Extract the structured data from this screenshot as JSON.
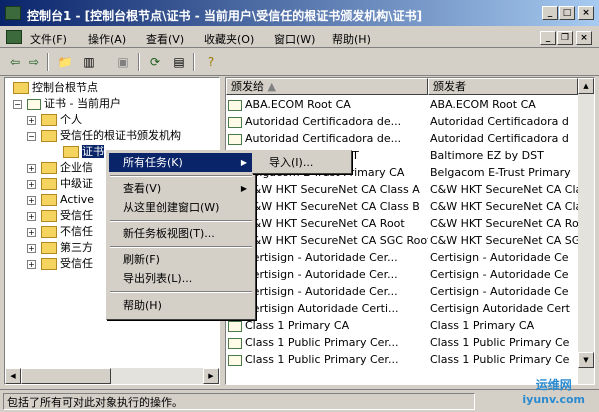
{
  "window": {
    "title": "控制台1 - [控制台根节点\\证书 - 当前用户\\受信任的根证书颁发机构\\证书]",
    "minimize": "_",
    "maximize": "□",
    "close": "×"
  },
  "menubar": {
    "items": [
      "文件(F)",
      "操作(A)",
      "查看(V)",
      "收藏夹(O)",
      "窗口(W)",
      "帮助(H)"
    ],
    "inner_min": "_",
    "inner_restore": "❐",
    "inner_close": "×"
  },
  "toolbar": {
    "buttons": [
      "back-icon",
      "forward-icon",
      "up-folder-icon",
      "show-tree-icon",
      "delete-icon",
      "refresh-icon",
      "export-icon",
      "help-icon"
    ]
  },
  "tree": {
    "items": [
      "控制台根节点",
      "证书 - 当前用户",
      "个人",
      "受信任的根证书颁发机构",
      "证书",
      "企业信",
      "中级证",
      "Active",
      "受信任",
      "不信任",
      "第三方",
      "受信任"
    ]
  },
  "list": {
    "headers": [
      "颁发给",
      "颁发者"
    ],
    "rows": [
      [
        "ABA.ECOM Root CA",
        "ABA.ECOM Root CA"
      ],
      [
        "Autoridad Certificadora de...",
        "Autoridad Certificadora d"
      ],
      [
        "Autoridad Certificadora de...",
        "Autoridad Certificadora d"
      ],
      [
        "Baltimore EZ by DST",
        "Baltimore EZ by DST"
      ],
      [
        "Belgacom E-Trust Primary CA",
        "Belgacom E-Trust Primary"
      ],
      [
        "C&W HKT SecureNet CA Class A",
        "C&W HKT SecureNet CA Clas"
      ],
      [
        "C&W HKT SecureNet CA Class B",
        "C&W HKT SecureNet CA Clas"
      ],
      [
        "C&W HKT SecureNet CA Root",
        "C&W HKT SecureNet CA Root"
      ],
      [
        "C&W HKT SecureNet CA SGC Root",
        "C&W HKT SecureNet CA SGC"
      ],
      [
        "Certisign - Autoridade Cer...",
        "Certisign - Autoridade Ce"
      ],
      [
        "Certisign - Autoridade Cer...",
        "Certisign - Autoridade Ce"
      ],
      [
        "Certisign - Autoridade Cer...",
        "Certisign - Autoridade Ce"
      ],
      [
        "Certisign Autoridade Certi...",
        "Certisign Autoridade Cert"
      ],
      [
        "Class 1 Primary CA",
        "Class 1 Primary CA"
      ],
      [
        "Class 1 Public Primary Cer...",
        "Class 1 Public Primary Ce"
      ],
      [
        "Class 1 Public Primary Cer...",
        "Class 1 Public Primary Ce"
      ]
    ]
  },
  "context_menu": {
    "items": [
      "所有任务(K)",
      "查看(V)",
      "从这里创建窗口(W)",
      "新任务板视图(T)...",
      "刷新(F)",
      "导出列表(L)...",
      "帮助(H)"
    ]
  },
  "submenu": {
    "items": [
      "导入(I)..."
    ]
  },
  "status": {
    "text": "包括了所有可对此对象执行的操作。"
  },
  "watermark": {
    "brand": "运维网",
    "url": "iyunv.com"
  }
}
